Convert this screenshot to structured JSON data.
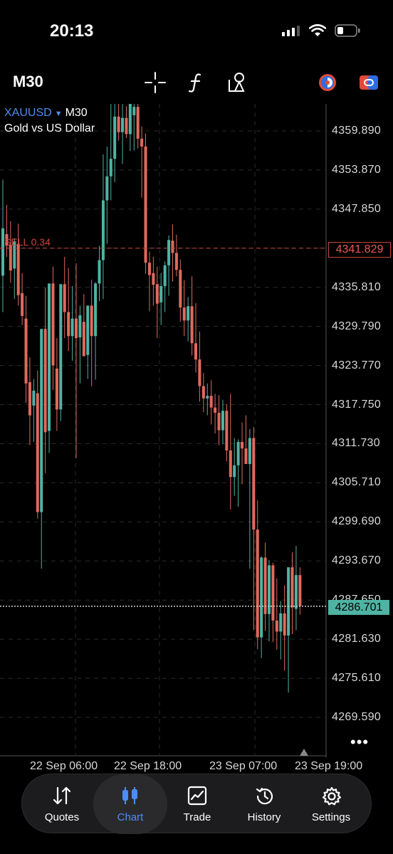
{
  "status": {
    "time": "20:13"
  },
  "toolbar": {
    "timeframe": "M30",
    "icons": [
      "crosshair-icon",
      "indicator-f-icon",
      "objects-icon",
      "color-theme-icon",
      "account-toggle-icon"
    ]
  },
  "chart": {
    "symbol": "XAUUSD",
    "timeframe": "M30",
    "description": "Gold vs US Dollar",
    "sell_label": "SELL 0.34",
    "sell_price": "4341.829",
    "current_price": "4286.701",
    "colors": {
      "bull": "#4fb3a3",
      "bear": "#e06a5e",
      "sell_line": "#c8453d",
      "grid": "#2a2a2a"
    }
  },
  "chart_data": {
    "type": "candlestick",
    "symbol": "XAUUSD",
    "price_ticks": [
      "4359.890",
      "4353.870",
      "4347.850",
      "4341.829",
      "4335.810",
      "4329.790",
      "4323.770",
      "4317.750",
      "4311.730",
      "4305.710",
      "4299.690",
      "4293.670",
      "4287.650",
      "4281.630",
      "4275.610",
      "4269.590"
    ],
    "time_ticks": [
      "22 Sep 06:00",
      "22 Sep 18:00",
      "23 Sep 07:00",
      "23 Sep 19:00"
    ],
    "ylim": [
      4266.5,
      4362.9
    ],
    "sell_level": 4341.829,
    "current_price": 4286.701,
    "candles": [
      {
        "o": 4337.6,
        "h": 4352.4,
        "l": 4332.0,
        "c": 4344.9
      },
      {
        "o": 4344.0,
        "h": 4348.5,
        "l": 4340.5,
        "c": 4342.2
      },
      {
        "o": 4342.3,
        "h": 4346.0,
        "l": 4336.5,
        "c": 4338.4
      },
      {
        "o": 4338.7,
        "h": 4343.4,
        "l": 4334.0,
        "c": 4342.9
      },
      {
        "o": 4342.5,
        "h": 4345.6,
        "l": 4333.0,
        "c": 4334.6
      },
      {
        "o": 4334.9,
        "h": 4338.0,
        "l": 4330.0,
        "c": 4331.4
      },
      {
        "o": 4331.0,
        "h": 4334.5,
        "l": 4318.0,
        "c": 4321.0
      },
      {
        "o": 4321.2,
        "h": 4325.0,
        "l": 4311.5,
        "c": 4316.1
      },
      {
        "o": 4317.6,
        "h": 4321.7,
        "l": 4312.0,
        "c": 4319.9
      },
      {
        "o": 4319.5,
        "h": 4323.0,
        "l": 4300.2,
        "c": 4301.2
      },
      {
        "o": 4301.2,
        "h": 4321.5,
        "l": 4292.5,
        "c": 4329.4
      },
      {
        "o": 4329.4,
        "h": 4335.7,
        "l": 4307.2,
        "c": 4313.5
      },
      {
        "o": 4313.7,
        "h": 4325.4,
        "l": 4310.3,
        "c": 4336.4
      },
      {
        "o": 4336.4,
        "h": 4339.0,
        "l": 4320.0,
        "c": 4323.8
      },
      {
        "o": 4323.3,
        "h": 4328.0,
        "l": 4313.7,
        "c": 4317.0
      },
      {
        "o": 4317.0,
        "h": 4335.0,
        "l": 4315.2,
        "c": 4336.3
      },
      {
        "o": 4336.3,
        "h": 4340.5,
        "l": 4328.0,
        "c": 4332.0
      },
      {
        "o": 4332.0,
        "h": 4338.8,
        "l": 4326.0,
        "c": 4328.3
      },
      {
        "o": 4328.3,
        "h": 4336.0,
        "l": 4324.5,
        "c": 4331.0
      },
      {
        "o": 4331.0,
        "h": 4339.5,
        "l": 4309.5,
        "c": 4328.0
      },
      {
        "o": 4328.1,
        "h": 4333.0,
        "l": 4321.0,
        "c": 4331.5
      },
      {
        "o": 4330.5,
        "h": 4334.8,
        "l": 4325.4,
        "c": 4325.2
      },
      {
        "o": 4325.4,
        "h": 4331.0,
        "l": 4321.7,
        "c": 4333.0
      },
      {
        "o": 4333.0,
        "h": 4337.0,
        "l": 4320.6,
        "c": 4328.3
      },
      {
        "o": 4328.3,
        "h": 4336.6,
        "l": 4321.6,
        "c": 4336.4
      },
      {
        "o": 4336.4,
        "h": 4342.2,
        "l": 4333.7,
        "c": 4340.0
      },
      {
        "o": 4340.0,
        "h": 4356.3,
        "l": 4334.0,
        "c": 4349.2
      },
      {
        "o": 4349.2,
        "h": 4357.5,
        "l": 4342.5,
        "c": 4352.9
      },
      {
        "o": 4352.9,
        "h": 4364.2,
        "l": 4349.2,
        "c": 4355.6
      },
      {
        "o": 4355.6,
        "h": 4364.7,
        "l": 4352.0,
        "c": 4362.1
      },
      {
        "o": 4362.1,
        "h": 4365.1,
        "l": 4358.4,
        "c": 4359.7
      },
      {
        "o": 4359.7,
        "h": 4365.0,
        "l": 4354.8,
        "c": 4361.9
      },
      {
        "o": 4361.9,
        "h": 4363.7,
        "l": 4358.8,
        "c": 4359.4
      },
      {
        "o": 4359.4,
        "h": 4365.0,
        "l": 4356.8,
        "c": 4364.6
      },
      {
        "o": 4362.3,
        "h": 4365.0,
        "l": 4356.9,
        "c": 4363.6
      },
      {
        "o": 4363.6,
        "h": 4365.2,
        "l": 4357.2,
        "c": 4358.7
      },
      {
        "o": 4358.7,
        "h": 4360.6,
        "l": 4349.6,
        "c": 4357.5
      },
      {
        "o": 4357.5,
        "h": 4359.5,
        "l": 4337.9,
        "c": 4339.6
      },
      {
        "o": 4339.6,
        "h": 4341.3,
        "l": 4332.1,
        "c": 4337.7
      },
      {
        "o": 4338.0,
        "h": 4340.5,
        "l": 4333.0,
        "c": 4336.2
      },
      {
        "o": 4336.3,
        "h": 4339.0,
        "l": 4328.0,
        "c": 4333.3
      },
      {
        "o": 4333.5,
        "h": 4338.0,
        "l": 4330.0,
        "c": 4336.0
      },
      {
        "o": 4336.0,
        "h": 4339.8,
        "l": 4332.0,
        "c": 4339.2
      },
      {
        "o": 4339.2,
        "h": 4343.8,
        "l": 4334.5,
        "c": 4343.1
      },
      {
        "o": 4343.0,
        "h": 4345.5,
        "l": 4336.7,
        "c": 4341.1
      },
      {
        "o": 4341.1,
        "h": 4343.9,
        "l": 4337.5,
        "c": 4338.5
      },
      {
        "o": 4338.5,
        "h": 4340.1,
        "l": 4330.5,
        "c": 4332.7
      },
      {
        "o": 4332.7,
        "h": 4336.9,
        "l": 4328.3,
        "c": 4330.7
      },
      {
        "o": 4330.7,
        "h": 4334.3,
        "l": 4327.5,
        "c": 4332.9
      },
      {
        "o": 4332.9,
        "h": 4337.5,
        "l": 4325.3,
        "c": 4327.2
      },
      {
        "o": 4327.2,
        "h": 4333.4,
        "l": 4322.7,
        "c": 4324.7
      },
      {
        "o": 4324.7,
        "h": 4329.0,
        "l": 4318.2,
        "c": 4320.6
      },
      {
        "o": 4320.6,
        "h": 4322.6,
        "l": 4316.6,
        "c": 4318.7
      },
      {
        "o": 4318.7,
        "h": 4321.0,
        "l": 4316.1,
        "c": 4319.1
      },
      {
        "o": 4319.1,
        "h": 4321.5,
        "l": 4314.7,
        "c": 4317.3
      },
      {
        "o": 4317.3,
        "h": 4319.4,
        "l": 4313.3,
        "c": 4316.5
      },
      {
        "o": 4316.5,
        "h": 4319.2,
        "l": 4311.5,
        "c": 4313.8
      },
      {
        "o": 4313.8,
        "h": 4318.5,
        "l": 4311.7,
        "c": 4316.8
      },
      {
        "o": 4316.8,
        "h": 4317.8,
        "l": 4309.0,
        "c": 4310.7
      },
      {
        "o": 4310.7,
        "h": 4319.4,
        "l": 4301.6,
        "c": 4306.6
      },
      {
        "o": 4306.6,
        "h": 4312.6,
        "l": 4303.7,
        "c": 4308.4
      },
      {
        "o": 4308.4,
        "h": 4312.4,
        "l": 4302.0,
        "c": 4312.0
      },
      {
        "o": 4312.0,
        "h": 4315.0,
        "l": 4305.5,
        "c": 4311.0
      },
      {
        "o": 4311.0,
        "h": 4316.1,
        "l": 4309.5,
        "c": 4308.6
      },
      {
        "o": 4308.6,
        "h": 4314.0,
        "l": 4292.5,
        "c": 4312.6
      },
      {
        "o": 4312.6,
        "h": 4314.3,
        "l": 4283.0,
        "c": 4298.5
      },
      {
        "o": 4298.5,
        "h": 4303.0,
        "l": 4280.1,
        "c": 4281.9
      },
      {
        "o": 4281.9,
        "h": 4294.4,
        "l": 4278.7,
        "c": 4294.2
      },
      {
        "o": 4294.2,
        "h": 4296.5,
        "l": 4282.9,
        "c": 4285.5
      },
      {
        "o": 4285.5,
        "h": 4293.8,
        "l": 4281.3,
        "c": 4293.0
      },
      {
        "o": 4293.0,
        "h": 4293.4,
        "l": 4281.2,
        "c": 4284.5
      },
      {
        "o": 4284.5,
        "h": 4291.0,
        "l": 4280.0,
        "c": 4282.8
      },
      {
        "o": 4282.8,
        "h": 4287.5,
        "l": 4278.5,
        "c": 4285.6
      },
      {
        "o": 4285.6,
        "h": 4289.9,
        "l": 4276.8,
        "c": 4282.2
      },
      {
        "o": 4282.2,
        "h": 4290.9,
        "l": 4273.4,
        "c": 4292.7
      },
      {
        "o": 4292.7,
        "h": 4295.0,
        "l": 4282.4,
        "c": 4286.5
      },
      {
        "o": 4286.3,
        "h": 4296.0,
        "l": 4283.0,
        "c": 4291.5
      },
      {
        "o": 4291.5,
        "h": 4292.7,
        "l": 4285.4,
        "c": 4286.7
      }
    ]
  },
  "tabs": [
    {
      "label": "Quotes",
      "icon": "quotes-arrows-icon"
    },
    {
      "label": "Chart",
      "icon": "chart-candles-icon"
    },
    {
      "label": "Trade",
      "icon": "trade-chart-icon"
    },
    {
      "label": "History",
      "icon": "history-clock-icon"
    },
    {
      "label": "Settings",
      "icon": "settings-gear-icon"
    }
  ],
  "more_label": "•••"
}
